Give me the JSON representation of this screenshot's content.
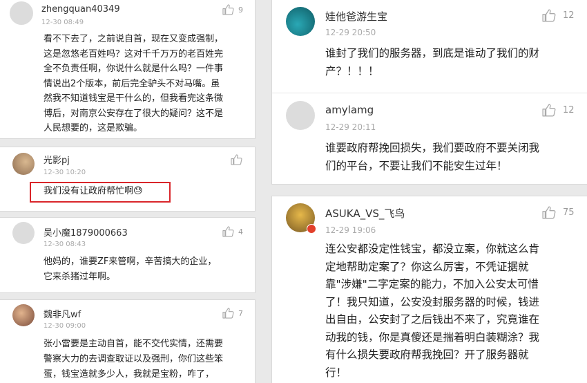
{
  "comments": [
    {
      "name": "zhengquan40349",
      "time": "12-30 08:49",
      "likes": "9",
      "lines": [
        "看不下去了，之前说自首，现在又变成强制，",
        "这是忽悠老百姓吗？这对千千万万的老百姓完",
        "全不负责任啊，你说什么就是什么吗？一件事",
        "情说出2个版本，前后完全驴头不对马嘴。虽",
        "然我不知道钱宝是干什么的，但我看完这条微",
        "博后，对南京公安存在了很大的疑问？这不是",
        "人民想要的，这是欺骗。"
      ]
    },
    {
      "name": "光影pj",
      "time": "12-30 10:20",
      "likes": "",
      "lines": [
        "我们没有让政府帮忙啊😓"
      ]
    },
    {
      "name": "吴小魔1879000663",
      "time": "12-30 08:43",
      "likes": "4",
      "lines": [
        "他妈的，谁要ZF来管啊，辛苦搞大的企业，",
        "它来杀猪过年啊。"
      ]
    },
    {
      "name": "魏非凡wf",
      "time": "12-30 09:00",
      "likes": "7",
      "lines": [
        "张小雷要是主动自首，能不交代实情，还需要",
        "警察大力的去调查取证以及强刑，你们这些笨",
        "蛋，钱宝造就多少人，我就是宝粉，咋了，"
      ]
    },
    {
      "name": "娃他爸游生宝",
      "time": "12-29 20:50",
      "likes": "12",
      "lines": [
        "谁封了我们的服务器，到底是谁动了我们的财",
        "产？！！！"
      ]
    },
    {
      "name": "amylamg",
      "time": "12-29 20:11",
      "likes": "12",
      "lines": [
        "谁要政府帮挽回损失，我们要政府不要关闭我",
        "们的平台，不要让我们不能安生过年！"
      ]
    },
    {
      "name": "ASUKA_VS_飞鸟",
      "time": "12-29 19:06",
      "likes": "75",
      "lines": [
        "连公安都没定性钱宝，都没立案，你就这么肯",
        "定地帮助定案了？你这么厉害，不凭证据就",
        "靠\"涉嫌\"二字定案的能力，不加入公安太可惜",
        "了！我只知道，公安没封服务器的时候，钱进",
        "出自由，公安封了之后钱出不来了，究竟谁在",
        "动我的钱，你是真傻还是揣着明白装糊涂？我",
        "有什么损失要政府帮我挽回？开了服务器就",
        "行！"
      ]
    }
  ],
  "colors": {
    "highlight_border": "#d9252a",
    "like_icon": "#aaaaaa"
  }
}
